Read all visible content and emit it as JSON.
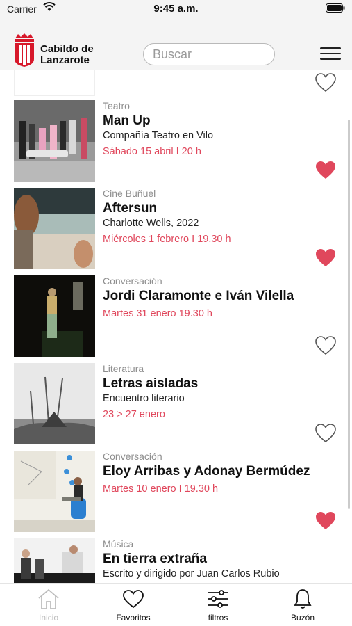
{
  "status_bar": {
    "carrier": "Carrier",
    "time": "9:45 a.m."
  },
  "header": {
    "logo_line1": "Cabildo de",
    "logo_line2": "Lanzarote",
    "search_placeholder": "Buscar"
  },
  "colors": {
    "accent": "#e0475c",
    "logo_red": "#d7182a",
    "muted": "#8e8e8e"
  },
  "events": [
    {
      "category": "Teatro",
      "title": "Man Up",
      "subtitle": "Compañía Teatro en Vilo",
      "date": "Sábado 15 abril I 20 h",
      "favorite": true
    },
    {
      "category": "Cine Buñuel",
      "title": "Aftersun",
      "subtitle": "Charlotte Wells, 2022",
      "date": "Miércoles 1 febrero I 19.30 h",
      "favorite": true
    },
    {
      "category": "Conversación",
      "title": "Jordi Claramonte e Iván Vilella",
      "subtitle": "",
      "date": "Martes 31 enero 19.30 h",
      "favorite": false
    },
    {
      "category": "Literatura",
      "title": "Letras aisladas",
      "subtitle": "Encuentro literario",
      "date": "23 > 27 enero",
      "favorite": false
    },
    {
      "category": "Conversación",
      "title": "Eloy Arribas y Adonay Bermúdez",
      "subtitle": "",
      "date": "Martes 10 enero I 19.30 h",
      "favorite": true
    },
    {
      "category": "Música",
      "title": "En tierra extraña",
      "subtitle": "Escrito y dirigido por Juan Carlos Rubio",
      "date": "",
      "favorite": false
    }
  ],
  "tabbar": [
    {
      "label": "Inicio",
      "icon": "home-icon",
      "active": false
    },
    {
      "label": "Favoritos",
      "icon": "heart-icon",
      "active": true
    },
    {
      "label": "filtros",
      "icon": "sliders-icon",
      "active": true
    },
    {
      "label": "Buzón",
      "icon": "bell-icon",
      "active": true
    }
  ]
}
